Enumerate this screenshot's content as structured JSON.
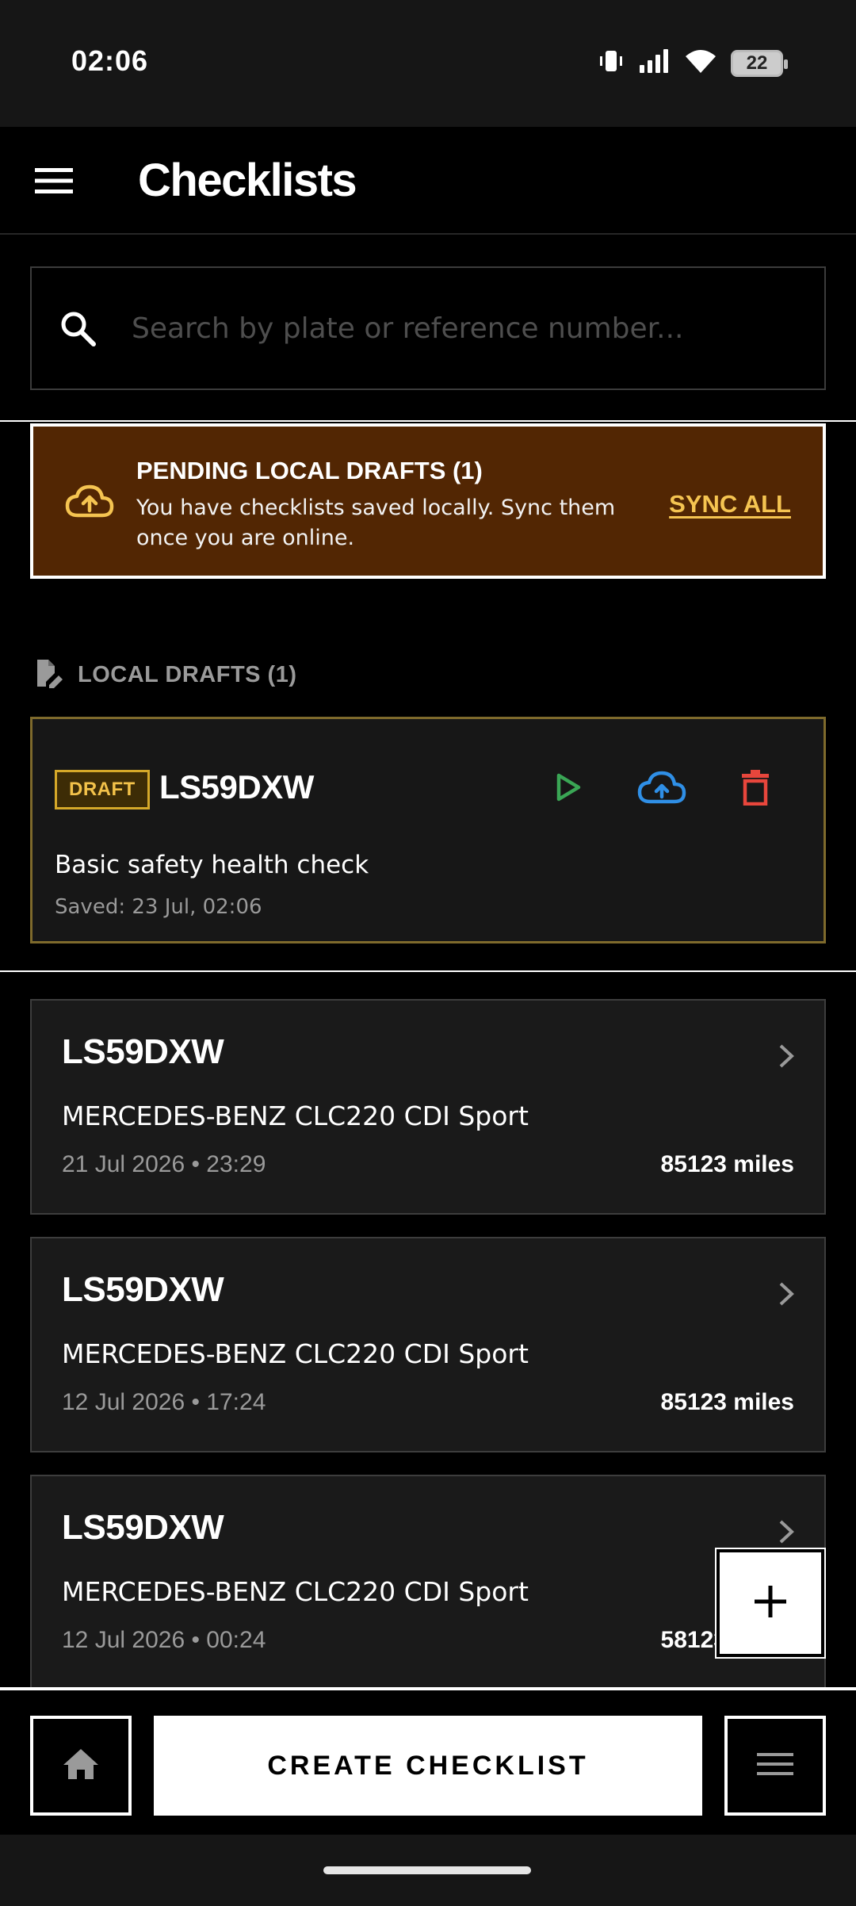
{
  "status_bar": {
    "time": "02:06",
    "battery": "22",
    "icons": [
      "vibrate-icon",
      "signal-icon",
      "wifi-icon",
      "battery-icon"
    ]
  },
  "app_bar": {
    "title": "Checklists",
    "menu_icon": "hamburger-menu-icon"
  },
  "search": {
    "placeholder": "Search by plate or reference number...",
    "value": ""
  },
  "banner": {
    "title": "PENDING LOCAL DRAFTS (1)",
    "message": "You have checklists saved locally. Sync them once you are online.",
    "action_label": "SYNC ALL",
    "icon": "cloud-upload-icon"
  },
  "drafts_section": {
    "label": "LOCAL DRAFTS (1)",
    "icon": "edit-document-icon",
    "items": [
      {
        "badge": "DRAFT",
        "plate": "LS59DXW",
        "description": "Basic safety health check",
        "saved": "Saved: 23 Jul, 02:06"
      }
    ]
  },
  "checklists": [
    {
      "plate": "LS59DXW",
      "model": "MERCEDES-BENZ CLC220 CDI Sport",
      "date": "21 Jul 2026 • 23:29",
      "miles": "85123 miles"
    },
    {
      "plate": "LS59DXW",
      "model": "MERCEDES-BENZ CLC220 CDI Sport",
      "date": "12 Jul 2026 • 17:24",
      "miles": "85123 miles"
    },
    {
      "plate": "LS59DXW",
      "model": "MERCEDES-BENZ CLC220 CDI Sport",
      "date": "12 Jul 2026 • 00:24",
      "miles": "58123 miles"
    }
  ],
  "bottom_bar": {
    "create_label": "CREATE CHECKLIST"
  },
  "colors": {
    "banner_background": "#522603",
    "sync_link": "#f5c451",
    "draft_badge": "#f3c24a",
    "play_action": "#3aa655",
    "upload_action": "#2f8fe6",
    "delete_action": "#e8463c"
  }
}
